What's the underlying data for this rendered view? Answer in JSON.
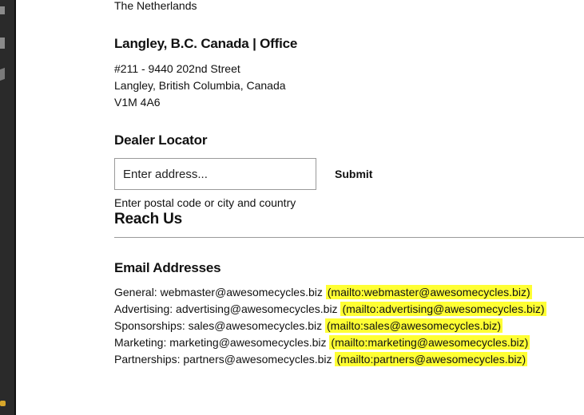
{
  "location_prev": {
    "country_line": "The Netherlands"
  },
  "office": {
    "title": "Langley, B.C. Canada | Office",
    "address_line1": "#211 - 9440 202nd Street",
    "address_line2": "Langley, British Columbia, Canada",
    "address_line3": "V1M 4A6"
  },
  "dealer_locator": {
    "title": "Dealer Locator",
    "input_placeholder": "Enter address...",
    "input_value": "",
    "submit_label": "Submit",
    "hint": "Enter postal code or city and country"
  },
  "reach_us": {
    "title": "Reach Us"
  },
  "email_addresses": {
    "title": "Email Addresses",
    "items": [
      {
        "label": "General:",
        "email": "webmaster@awesomecycles.biz",
        "mailto": "(mailto:webmaster@awesomecycles.biz)"
      },
      {
        "label": "Advertising:",
        "email": "advertising@awesomecycles.biz",
        "mailto": "(mailto:advertising@awesomecycles.biz)"
      },
      {
        "label": "Sponsorships:",
        "email": "sales@awesomecycles.biz",
        "mailto": "(mailto:sales@awesomecycles.biz)"
      },
      {
        "label": "Marketing:",
        "email": "marketing@awesomecycles.biz",
        "mailto": "(mailto:marketing@awesomecycles.biz)"
      },
      {
        "label": "Partnerships:",
        "email": "partners@awesomecycles.biz",
        "mailto": "(mailto:partners@awesomecycles.biz)"
      }
    ]
  },
  "colors": {
    "highlight": "#ffff33",
    "rail": "#2a2a2a"
  },
  "icons": [
    "document-icon",
    "document-icon",
    "pen-icon",
    "badge-icon"
  ]
}
